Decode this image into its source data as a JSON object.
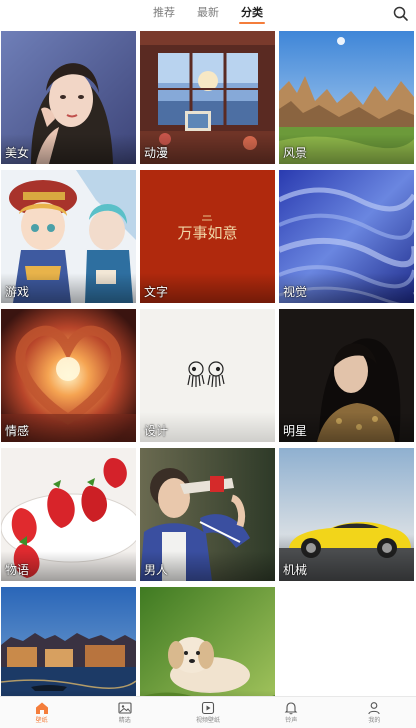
{
  "header": {
    "tabs": [
      {
        "label": "推荐",
        "active": false
      },
      {
        "label": "最新",
        "active": false
      },
      {
        "label": "分类",
        "active": true
      }
    ],
    "search_icon": "search-icon"
  },
  "categories": [
    {
      "label": "美女"
    },
    {
      "label": "动漫"
    },
    {
      "label": "风景"
    },
    {
      "label": "游戏"
    },
    {
      "label": "文字",
      "artwork_text": "万事如意"
    },
    {
      "label": "视觉"
    },
    {
      "label": "情感"
    },
    {
      "label": "设计"
    },
    {
      "label": "明星"
    },
    {
      "label": "物语"
    },
    {
      "label": "男人"
    },
    {
      "label": "机械"
    },
    {
      "label": ""
    },
    {
      "label": ""
    }
  ],
  "bottom_nav": {
    "items": [
      {
        "label": "壁纸",
        "icon": "home-icon",
        "active": true
      },
      {
        "label": "精选",
        "icon": "image-icon",
        "active": false
      },
      {
        "label": "视频壁纸",
        "icon": "play-icon",
        "active": false
      },
      {
        "label": "铃声",
        "icon": "bell-icon",
        "active": false
      },
      {
        "label": "我的",
        "icon": "user-icon",
        "active": false
      }
    ]
  },
  "colors": {
    "accent": "#f47d3b",
    "tab_inactive": "#7d7d7d"
  }
}
